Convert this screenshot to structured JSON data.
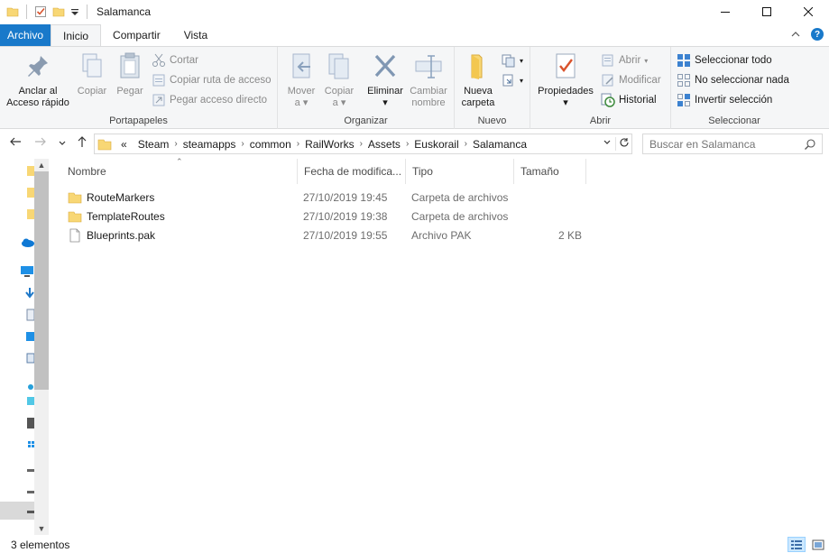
{
  "window": {
    "title": "Salamanca"
  },
  "tabs": [
    {
      "label": "Archivo"
    },
    {
      "label": "Inicio"
    },
    {
      "label": "Compartir"
    },
    {
      "label": "Vista"
    }
  ],
  "ribbon": {
    "portapapeles": {
      "label": "Portapapeles",
      "anclar_line1": "Anclar al",
      "anclar_line2": "Acceso rápido",
      "copiar": "Copiar",
      "pegar": "Pegar",
      "cortar": "Cortar",
      "copiar_ruta": "Copiar ruta de acceso",
      "pegar_acceso": "Pegar acceso directo"
    },
    "organizar": {
      "label": "Organizar",
      "mover_line1": "Mover",
      "mover_line2": "a",
      "copiar_line1": "Copiar",
      "copiar_line2": "a",
      "eliminar": "Eliminar",
      "cambiar_line1": "Cambiar",
      "cambiar_line2": "nombre"
    },
    "nuevo": {
      "label": "Nuevo",
      "nueva_line1": "Nueva",
      "nueva_line2": "carpeta"
    },
    "abrir": {
      "label": "Abrir",
      "propiedades": "Propiedades",
      "abrir": "Abrir",
      "modificar": "Modificar",
      "historial": "Historial"
    },
    "seleccionar": {
      "label": "Seleccionar",
      "todo": "Seleccionar todo",
      "ninguno": "No seleccionar nada",
      "invertir": "Invertir selección"
    }
  },
  "address": {
    "overflow": "«",
    "crumbs": [
      "Steam",
      "steamapps",
      "common",
      "RailWorks",
      "Assets",
      "Euskorail",
      "Salamanca"
    ]
  },
  "search": {
    "placeholder": "Buscar en Salamanca"
  },
  "columns": {
    "name": "Nombre",
    "date": "Fecha de modifica...",
    "type": "Tipo",
    "size": "Tamaño"
  },
  "files": [
    {
      "name": "RouteMarkers",
      "date": "27/10/2019 19:45",
      "type": "Carpeta de archivos",
      "size": "",
      "icon": "folder-icon"
    },
    {
      "name": "TemplateRoutes",
      "date": "27/10/2019 19:38",
      "type": "Carpeta de archivos",
      "size": "",
      "icon": "folder-icon"
    },
    {
      "name": "Blueprints.pak",
      "date": "27/10/2019 19:55",
      "type": "Archivo PAK",
      "size": "2 KB",
      "icon": "file-icon"
    }
  ],
  "status": {
    "count": "3 elementos"
  },
  "colors": {
    "accent": "#1979ca",
    "folder": "#f8d775",
    "ribbon_bg": "#f5f6f7"
  }
}
